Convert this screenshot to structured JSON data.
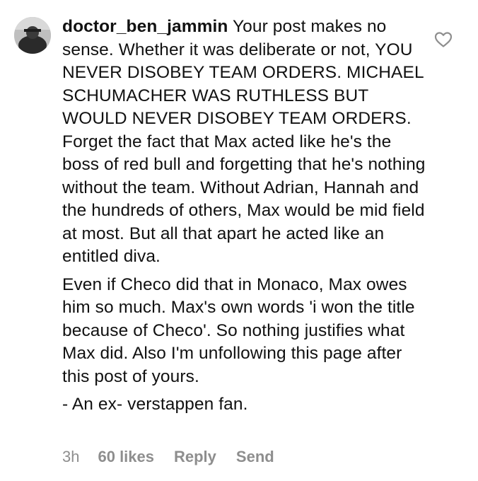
{
  "comment": {
    "username": "doctor_ben_jammin",
    "paragraphs": [
      "Your post makes no sense. Whether it was deliberate or not, YOU NEVER DISOBEY TEAM ORDERS. MICHAEL SCHUMACHER WAS RUTHLESS BUT WOULD NEVER DISOBEY TEAM ORDERS.  Forget the fact that Max acted like he's the boss of red bull and forgetting that he's nothing without the team. Without Adrian, Hannah and the hundreds of others, Max would be mid field at most. But all that apart he acted like an entitled diva.",
      "Even if Checo did that in Monaco, Max owes him so much. Max's own words 'i won the title because of Checo'. So nothing justifies what Max did. Also I'm unfollowing this page after this post of yours.",
      "- An ex- verstappen fan."
    ],
    "time": "3h",
    "likes": "60 likes",
    "reply_label": "Reply",
    "send_label": "Send"
  },
  "icons": {
    "like": "heart-outline-icon",
    "avatar": "profile-picture"
  },
  "colors": {
    "text": "#111111",
    "meta": "#8e8e8e",
    "heart_stroke": "#8e8e8e"
  }
}
